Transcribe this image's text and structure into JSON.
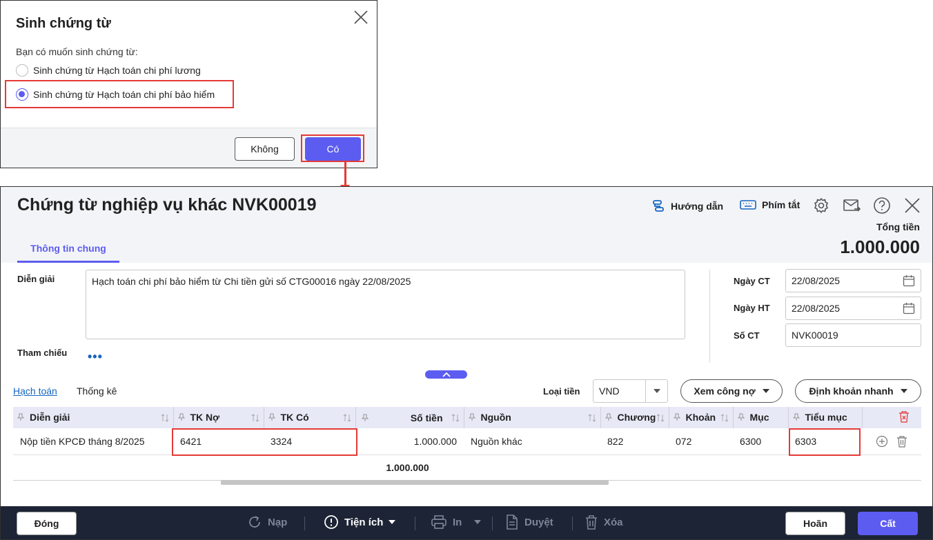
{
  "dialog": {
    "title": "Sinh chứng từ",
    "question": "Bạn có muốn sinh chứng từ:",
    "options": [
      {
        "label": "Sinh chứng từ Hạch toán chi phí lương",
        "checked": false
      },
      {
        "label": "Sinh chứng từ Hạch toán chi phí bảo hiểm",
        "checked": true
      }
    ],
    "no_label": "Không",
    "yes_label": "Có"
  },
  "header": {
    "title": "Chứng từ nghiệp vụ khác NVK00019",
    "guide_label": "Hướng dẫn",
    "shortcut_label": "Phím tắt",
    "total_label": "Tổng tiền",
    "total_value": "1.000.000",
    "tab_general": "Thông tin chung"
  },
  "form": {
    "dien_giai_label": "Diễn giải",
    "dien_giai_value": "Hạch toán chi phí bảo hiểm từ Chi tiền gửi số CTG00016 ngày 22/08/2025",
    "tham_chieu_label": "Tham chiếu",
    "more_dots": "•••",
    "ngay_ct_label": "Ngày CT",
    "ngay_ct_value": "22/08/2025",
    "ngay_ht_label": "Ngày HT",
    "ngay_ht_value": "22/08/2025",
    "so_ct_label": "Số CT",
    "so_ct_value": "NVK00019"
  },
  "grid_toolbar": {
    "tab_hachtoan": "Hạch toán",
    "tab_thongke": "Thống kê",
    "currency_label": "Loại tiền",
    "currency_value": "VND",
    "xem_cong_no": "Xem công nợ",
    "dinh_khoan_nhanh": "Định khoản nhanh"
  },
  "grid": {
    "columns": [
      "Diễn giải",
      "TK Nợ",
      "TK Có",
      "Số tiền",
      "Nguồn",
      "Chương",
      "Khoản",
      "Mục",
      "Tiểu mục"
    ],
    "rows": [
      [
        "Nộp tiền KPCĐ tháng 8/2025",
        "6421",
        "3324",
        "1.000.000",
        "Nguồn khác",
        "822",
        "072",
        "6300",
        "6303"
      ]
    ],
    "total": "1.000.000"
  },
  "footer": {
    "close": "Đóng",
    "reload": "Nạp",
    "utilities": "Tiện ích",
    "print": "In",
    "approve": "Duyệt",
    "delete": "Xóa",
    "undo": "Hoãn",
    "save": "Cất"
  },
  "colors": {
    "accent": "#5c5cf0",
    "highlight": "#e53935",
    "footer_bg": "#1d2435"
  }
}
